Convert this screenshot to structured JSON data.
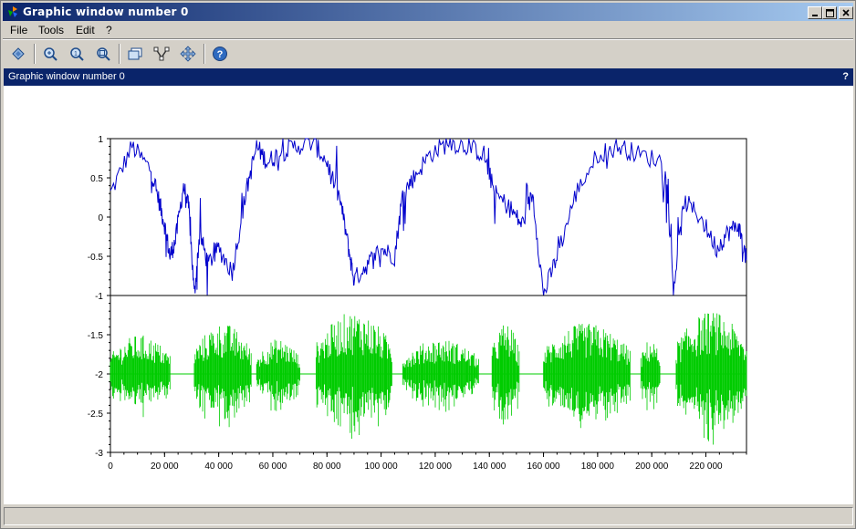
{
  "window": {
    "title": "Graphic window number 0"
  },
  "menu": [
    "File",
    "Tools",
    "Edit",
    "?"
  ],
  "toolbar": {
    "buttons": [
      "rotate-icon",
      "zoom-icon",
      "zoom-reset-icon",
      "zoom-region-icon",
      "new-window-icon",
      "datatip-icon",
      "pan-icon",
      "help-icon"
    ]
  },
  "dock": {
    "title": "Graphic window number 0",
    "help": "?"
  },
  "colors": {
    "top_series": "#0000cc",
    "bottom_series": "#00cc00"
  },
  "chart_data": [
    {
      "type": "line",
      "title": "",
      "xlabel": "",
      "ylabel": "",
      "xlim": [
        0,
        235000
      ],
      "ylim": [
        -1,
        1
      ],
      "yticks": [
        -1,
        -0.5,
        0,
        0.5,
        1
      ],
      "ytick_labels": [
        "-1",
        "-0.5",
        "0",
        "0.5",
        "1"
      ],
      "series": [
        {
          "color": "#0000cc",
          "x": [
            0,
            8000,
            15000,
            18000,
            20000,
            22000,
            24000,
            27000,
            29000,
            31000,
            33000,
            36000,
            40000,
            45000,
            50000,
            54000,
            58000,
            62000,
            68000,
            75000,
            80000,
            85000,
            88000,
            90000,
            95000,
            100000,
            105000,
            108000,
            112000,
            118000,
            125000,
            132000,
            138000,
            142000,
            148000,
            152000,
            156000,
            160000,
            165000,
            172000,
            180000,
            188000,
            195000,
            205000,
            208000,
            212000,
            218000,
            224000,
            228000,
            232000,
            235000
          ],
          "y": [
            0.3,
            0.9,
            0.6,
            0.2,
            -0.1,
            -0.5,
            -0.3,
            0.4,
            0.1,
            -1.0,
            -0.2,
            -0.6,
            -0.4,
            -0.7,
            0.3,
            0.9,
            0.7,
            0.8,
            0.9,
            0.95,
            0.7,
            0.2,
            -0.4,
            -0.8,
            -0.6,
            -0.4,
            -0.5,
            0.3,
            0.5,
            0.8,
            0.95,
            0.9,
            0.8,
            0.3,
            0.1,
            -0.1,
            0.3,
            -1.0,
            -0.5,
            0.3,
            0.8,
            0.9,
            0.8,
            0.7,
            -0.9,
            0.2,
            0.0,
            -0.4,
            -0.2,
            -0.1,
            -0.55
          ]
        }
      ]
    },
    {
      "type": "line",
      "title": "",
      "xlabel": "",
      "ylabel": "",
      "xlim": [
        0,
        235000
      ],
      "ylim": [
        -3,
        -1
      ],
      "yticks": [
        -3,
        -2.5,
        -2,
        -1.5
      ],
      "ytick_labels": [
        "-3",
        "-2.5",
        "-2",
        "-1.5"
      ],
      "xticks": [
        0,
        20000,
        40000,
        60000,
        80000,
        100000,
        120000,
        140000,
        160000,
        180000,
        200000,
        220000
      ],
      "xtick_labels": [
        "0",
        "20 000",
        "40 000",
        "60 000",
        "80 000",
        "100 000",
        "120 000",
        "140 000",
        "160 000",
        "180 000",
        "200 000",
        "220 000"
      ],
      "series": [
        {
          "color": "#00cc00",
          "center": -2,
          "bursts": [
            [
              0,
              22000,
              0.5
            ],
            [
              31000,
              52000,
              0.65
            ],
            [
              54000,
              70000,
              0.45
            ],
            [
              76000,
              104000,
              0.8
            ],
            [
              108000,
              136000,
              0.45
            ],
            [
              141000,
              151000,
              0.65
            ],
            [
              160000,
              192000,
              0.65
            ],
            [
              196000,
              203000,
              0.45
            ],
            [
              209000,
              235000,
              0.8
            ]
          ]
        }
      ]
    }
  ]
}
